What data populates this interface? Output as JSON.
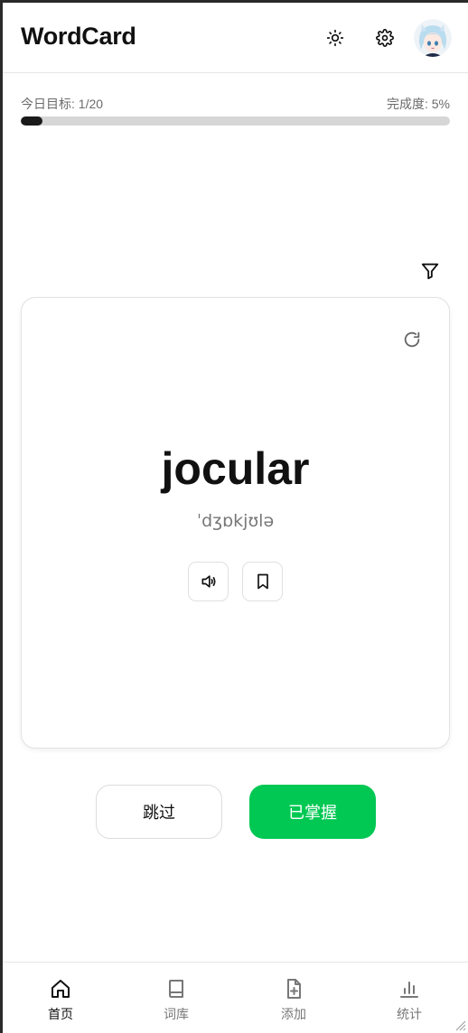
{
  "header": {
    "title": "WordCard",
    "theme_icon": "sun-icon",
    "settings_icon": "gear-icon",
    "avatar": "user-avatar"
  },
  "progress": {
    "goal_label": "今日目标: 1/20",
    "completion_label": "完成度: 5%",
    "completion_fraction": 0.05
  },
  "filter": {
    "icon": "filter-icon"
  },
  "card": {
    "word": "jocular",
    "phonetic": "ˈdʒɒkjʊlə",
    "flip_icon": "refresh-icon",
    "speak_icon": "speaker-icon",
    "bookmark_icon": "bookmark-icon"
  },
  "actions": {
    "skip_label": "跳过",
    "master_label": "已掌握"
  },
  "colors": {
    "accent_green": "#00c853",
    "progress_fill": "#1a1a1a",
    "progress_track": "#d6d6d6"
  },
  "nav": {
    "items": [
      {
        "label": "首页",
        "icon": "home-icon",
        "active": true
      },
      {
        "label": "词库",
        "icon": "book-icon",
        "active": false
      },
      {
        "label": "添加",
        "icon": "file-plus-icon",
        "active": false
      },
      {
        "label": "统计",
        "icon": "bar-chart-icon",
        "active": false
      }
    ]
  }
}
